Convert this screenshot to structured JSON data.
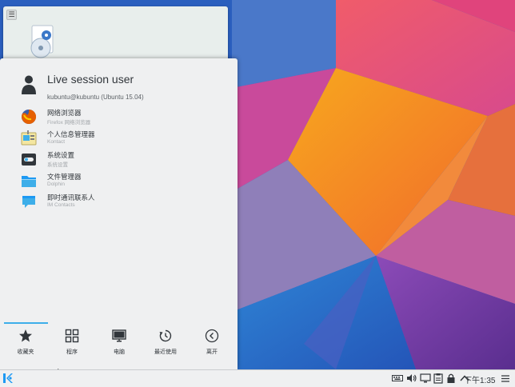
{
  "user": {
    "name": "Live session user",
    "host": "kubuntu@kubuntu (Ubuntu 15.04)"
  },
  "favorites": [
    {
      "name": "网络浏览器",
      "desc": "Firefox 网络浏览器",
      "icon": "firefox-icon"
    },
    {
      "name": "个人信息管理器",
      "desc": "Kontact",
      "icon": "kontact-icon"
    },
    {
      "name": "系统设置",
      "desc": "系统设置",
      "icon": "system-settings-icon"
    },
    {
      "name": "文件管理器",
      "desc": "Dolphin",
      "icon": "dolphin-icon"
    },
    {
      "name": "即时通讯联系人",
      "desc": "IM Contacts",
      "icon": "im-contacts-icon"
    }
  ],
  "tabs": [
    {
      "label": "收藏夹",
      "icon": "star-icon",
      "active": true
    },
    {
      "label": "程序",
      "icon": "grid-icon",
      "active": false
    },
    {
      "label": "电脑",
      "icon": "monitor-icon",
      "active": false
    },
    {
      "label": "最近使用",
      "icon": "history-icon",
      "active": false
    },
    {
      "label": "离开",
      "icon": "leave-icon",
      "active": false
    }
  ],
  "panel": {
    "clock": "下午1:35",
    "tray_icons": [
      "keyboard-icon",
      "volume-icon",
      "display-icon",
      "clipboard-icon",
      "lock-icon",
      "chevron-up-icon"
    ]
  },
  "colors": {
    "accent": "#3daee9",
    "launcher_bg": "#eff0f1",
    "text": "#31363b"
  }
}
